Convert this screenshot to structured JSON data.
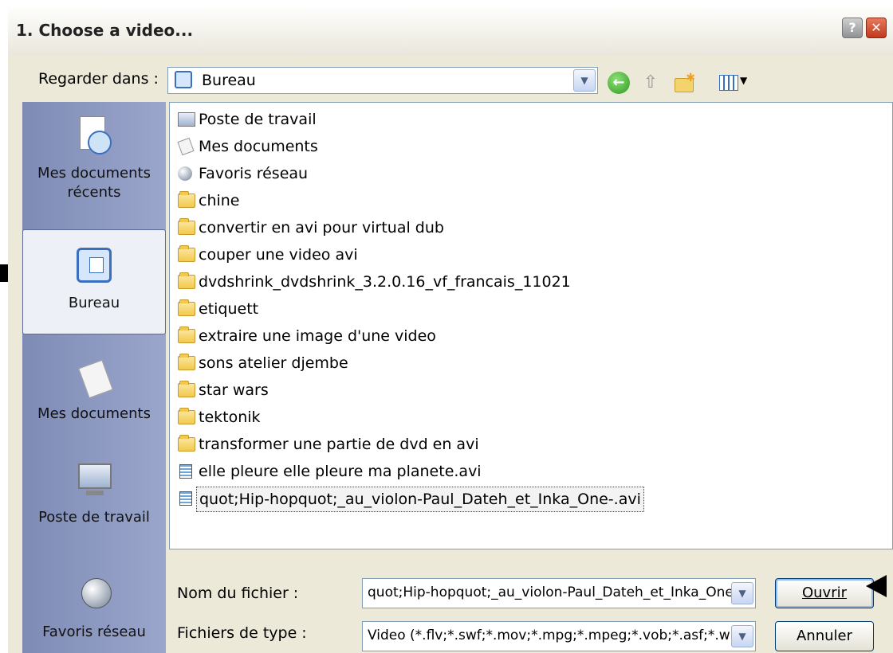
{
  "window": {
    "title": "1. Choose a video...",
    "help_label": "?",
    "close_label": "✕"
  },
  "lookin": {
    "label": "Regarder dans :",
    "value": "Bureau"
  },
  "places": [
    {
      "label_line1": "Mes documents",
      "label_line2": "récents"
    },
    {
      "label_line1": "Bureau",
      "label_line2": ""
    },
    {
      "label_line1": "Mes documents",
      "label_line2": ""
    },
    {
      "label_line1": "Poste de travail",
      "label_line2": ""
    },
    {
      "label_line1": "Favoris réseau",
      "label_line2": ""
    }
  ],
  "files": [
    {
      "name": "Poste de travail",
      "icon": "computer-icon"
    },
    {
      "name": "Mes documents",
      "icon": "documents-icon"
    },
    {
      "name": "Favoris réseau",
      "icon": "network-icon"
    },
    {
      "name": "chine",
      "icon": "folder-icon"
    },
    {
      "name": "convertir en avi pour virtual dub",
      "icon": "folder-icon"
    },
    {
      "name": "couper une video avi",
      "icon": "folder-icon"
    },
    {
      "name": "dvdshrink_dvdshrink_3.2.0.16_vf_francais_11021",
      "icon": "folder-icon"
    },
    {
      "name": "etiquett",
      "icon": "folder-icon"
    },
    {
      "name": "extraire une image d'une video",
      "icon": "folder-icon"
    },
    {
      "name": "sons atelier djembe",
      "icon": "folder-icon"
    },
    {
      "name": "star wars",
      "icon": "folder-icon"
    },
    {
      "name": "tektonik",
      "icon": "folder-icon"
    },
    {
      "name": "transformer une partie de dvd en avi",
      "icon": "folder-icon"
    },
    {
      "name": "elle pleure elle pleure ma planete.avi",
      "icon": "video-file-icon"
    },
    {
      "name": "quot;Hip-hopquot;_au_violon-Paul_Dateh_et_Inka_One-.avi",
      "icon": "video-file-icon",
      "selected": true
    }
  ],
  "filename": {
    "label": "Nom du fichier :",
    "value": "quot;Hip-hopquot;_au_violon-Paul_Dateh_et_Inka_One-.avi"
  },
  "filetype": {
    "label": "Fichiers de type :",
    "value": "Video (*.flv;*.swf;*.mov;*.mpg;*.mpeg;*.vob;*.asf;*.wmv)"
  },
  "buttons": {
    "open": "Ouvrir",
    "cancel": "Annuler"
  },
  "colors": {
    "accent": "#003c74",
    "places_bar": "#7e8bb5",
    "folder": "#f2c94c"
  }
}
